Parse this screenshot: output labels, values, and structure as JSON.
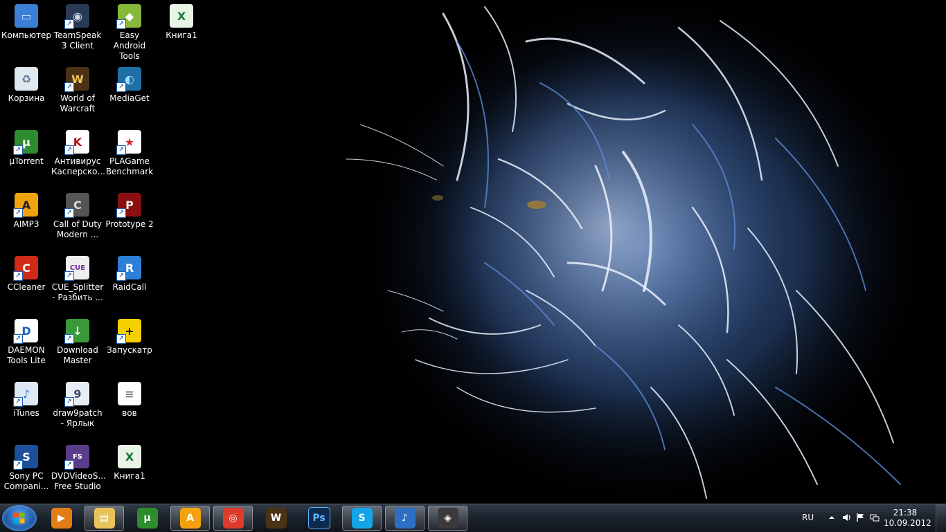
{
  "desktop": {
    "icons": [
      {
        "label": "Компьютер",
        "icon": "computer-icon"
      },
      {
        "label": "TeamSpeak 3 Client",
        "icon": "teamspeak-icon"
      },
      {
        "label": "Easy Android Tools",
        "icon": "android-icon"
      },
      {
        "label": "Книга1",
        "icon": "excel-icon"
      },
      {
        "label": "Корзина",
        "icon": "recycle-bin-icon"
      },
      {
        "label": "World of Warcraft",
        "icon": "wow-icon"
      },
      {
        "label": "MediaGet",
        "icon": "mediaget-icon"
      },
      {
        "label": "µTorrent",
        "icon": "utorrent-icon"
      },
      {
        "label": "Антивирус Касперско...",
        "icon": "kaspersky-icon"
      },
      {
        "label": "PLAGame Benchmark",
        "icon": "plagame-icon"
      },
      {
        "label": "AIMP3",
        "icon": "aimp-icon"
      },
      {
        "label": "Call of Duty Modern ...",
        "icon": "call-of-duty-icon"
      },
      {
        "label": "Prototype 2",
        "icon": "prototype-icon"
      },
      {
        "label": "CCleaner",
        "icon": "ccleaner-icon"
      },
      {
        "label": "CUE_Splitter - Разбить ...",
        "icon": "cue-splitter-icon"
      },
      {
        "label": "RaidCall",
        "icon": "raidcall-icon"
      },
      {
        "label": "DAEMON Tools Lite",
        "icon": "daemon-tools-icon"
      },
      {
        "label": "Download Master",
        "icon": "download-master-icon"
      },
      {
        "label": "Запускатр",
        "icon": "launcher-icon"
      },
      {
        "label": "iTunes",
        "icon": "itunes-icon"
      },
      {
        "label": "draw9patch - Ярлык",
        "icon": "draw9patch-icon"
      },
      {
        "label": "вов",
        "icon": "text-file-icon"
      },
      {
        "label": "Sony PC Compani...",
        "icon": "sony-pc-companion-icon"
      },
      {
        "label": "DVDVideoS... Free Studio",
        "icon": "dvdvideosoft-icon"
      },
      {
        "label": "Книга1",
        "icon": "excel-icon"
      }
    ]
  },
  "taskbar": {
    "pinned": [
      {
        "icon": "media-player-icon"
      },
      {
        "icon": "explorer-icon",
        "active": true
      },
      {
        "icon": "utorrent-icon"
      },
      {
        "icon": "aimp-icon",
        "active": true
      },
      {
        "icon": "chrome-icon",
        "active": true
      },
      {
        "icon": "wow-icon"
      },
      {
        "icon": "photoshop-icon",
        "text": "Ps"
      },
      {
        "icon": "skype-icon",
        "active": true
      },
      {
        "icon": "itunes-icon",
        "active": true
      },
      {
        "icon": "game-launcher-icon",
        "active": true
      }
    ],
    "tray": {
      "language": "RU",
      "time": "21:38",
      "date": "10.09.2012",
      "icons": [
        "show-hidden-icon",
        "volume-icon",
        "action-center-flag-icon",
        "network-icon"
      ]
    }
  },
  "colors": {
    "wallpaper_bg": "#000000",
    "tiger_blue": "#4f7fd0",
    "tiger_white": "#e8eef8",
    "taskbar": "#1c232d"
  }
}
